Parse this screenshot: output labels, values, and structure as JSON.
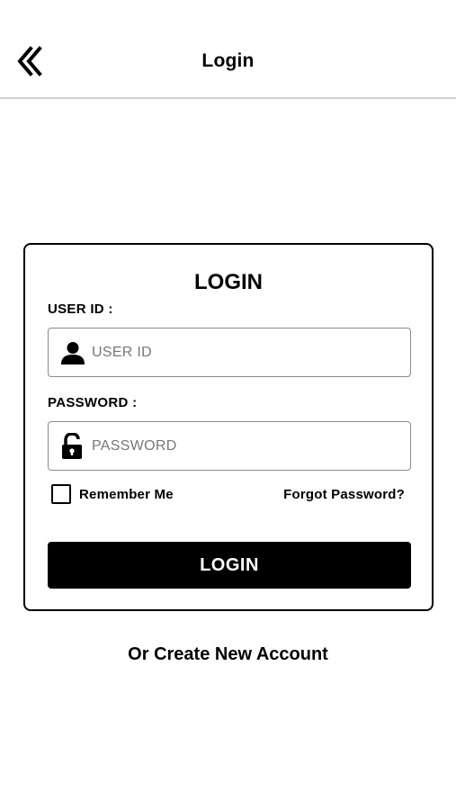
{
  "header": {
    "back_icon": "double-chevron-left-icon",
    "title": "Login"
  },
  "card": {
    "title": "LOGIN",
    "user_id": {
      "label": "USER ID :",
      "icon": "user-icon",
      "placeholder": "USER ID",
      "value": ""
    },
    "password": {
      "label": "PASSWORD :",
      "icon": "unlock-icon",
      "placeholder": "PASSWORD",
      "value": ""
    },
    "remember_me": {
      "label": "Remember Me",
      "checked": false
    },
    "forgot_password": "Forgot Password?",
    "login_button": "LOGIN"
  },
  "create_account": "Or Create New Account"
}
